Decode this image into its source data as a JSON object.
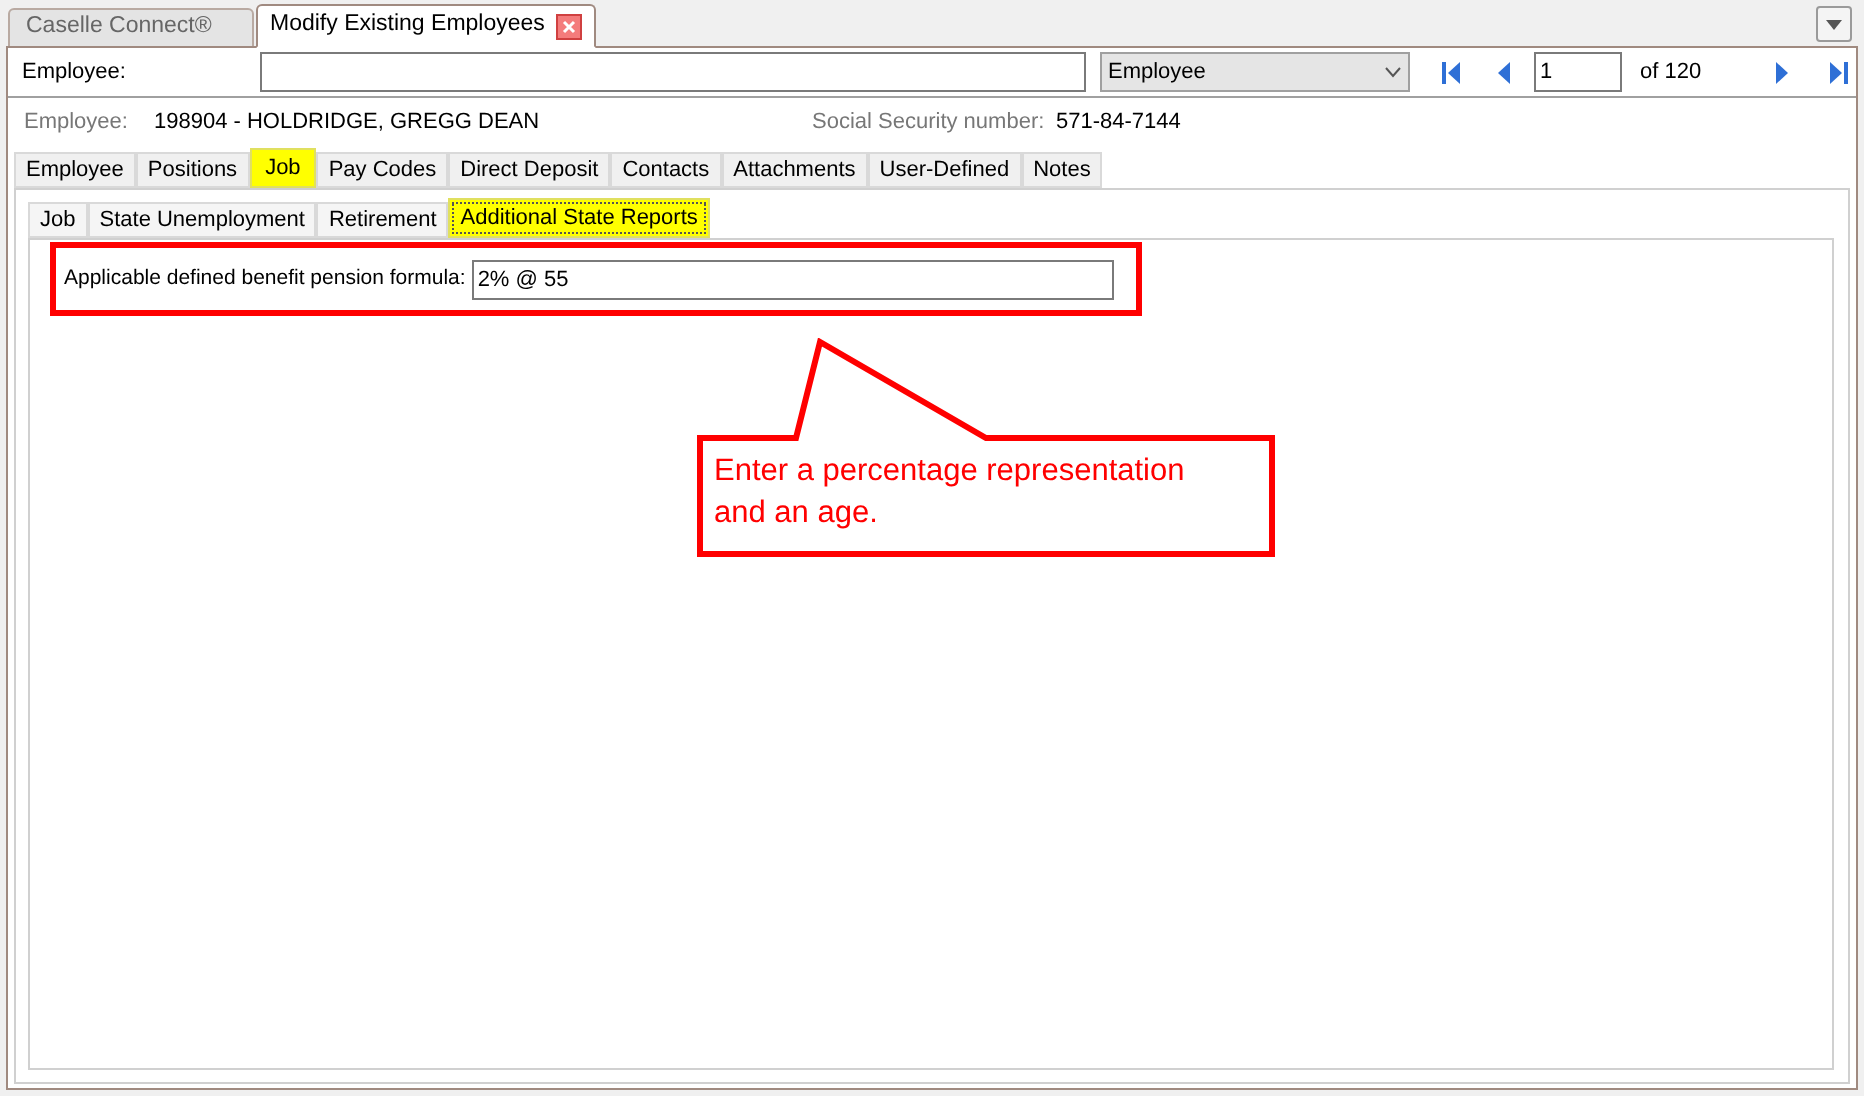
{
  "app_tabs": [
    {
      "label": "Caselle Connect®",
      "selected": false,
      "closable": false
    },
    {
      "label": "Modify Existing Employees",
      "selected": true,
      "closable": true
    }
  ],
  "lookup": {
    "label": "Employee:",
    "type_select": "Employee",
    "record": "1",
    "of_total": "of 120"
  },
  "employee": {
    "label": "Employee:",
    "value": "198904 - HOLDRIDGE, GREGG DEAN",
    "ssn_label": "Social Security number:",
    "ssn": "571-84-7144"
  },
  "tabs": [
    {
      "label": "Employee",
      "selected": false
    },
    {
      "label": "Positions",
      "selected": false
    },
    {
      "label": "Job",
      "selected": true
    },
    {
      "label": "Pay Codes",
      "selected": false
    },
    {
      "label": "Direct Deposit",
      "selected": false
    },
    {
      "label": "Contacts",
      "selected": false
    },
    {
      "label": "Attachments",
      "selected": false
    },
    {
      "label": "User-Defined",
      "selected": false
    },
    {
      "label": "Notes",
      "selected": false
    }
  ],
  "subtabs": [
    {
      "label": "Job",
      "selected": false
    },
    {
      "label": "State Unemployment",
      "selected": false
    },
    {
      "label": "Retirement",
      "selected": false
    },
    {
      "label": "Additional State Reports",
      "selected": true
    }
  ],
  "field": {
    "label": "Applicable defined benefit pension formula:",
    "value": "2% @ 55"
  },
  "annotation": {
    "text": "Enter a percentage representation and an age."
  }
}
